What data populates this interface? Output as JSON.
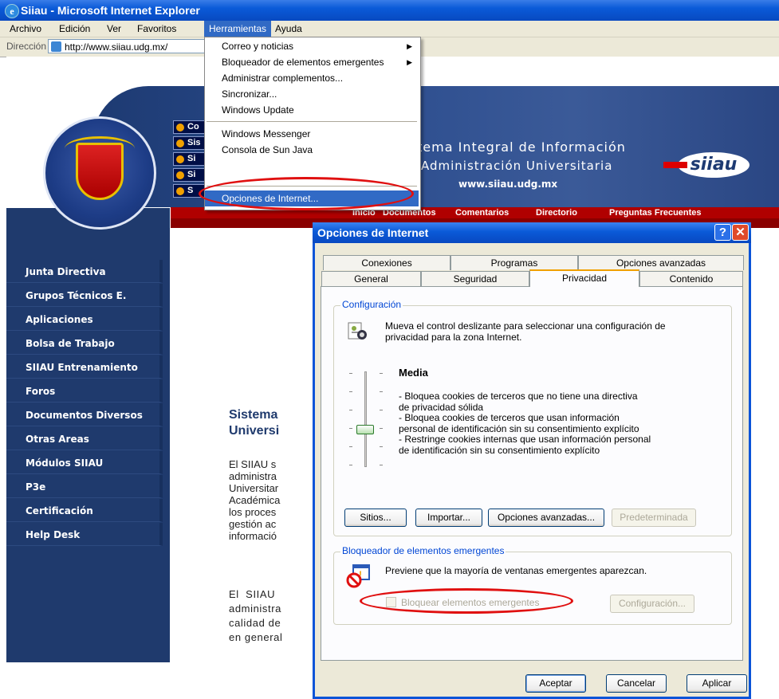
{
  "window": {
    "title": "Siiau - Microsoft Internet Explorer"
  },
  "menubar": {
    "items": [
      "Archivo",
      "Edición",
      "Ver",
      "Favoritos",
      "Herramientas",
      "Ayuda"
    ]
  },
  "addressbar": {
    "label": "Dirección",
    "value": "http://www.siiau.udg.mx/"
  },
  "tools_menu": {
    "items": [
      {
        "label": "Correo y noticias",
        "submenu": true
      },
      {
        "label": "Bloqueador de elementos emergentes",
        "submenu": true
      },
      {
        "label": "Administrar complementos..."
      },
      {
        "label": "Sincronizar..."
      },
      {
        "label": "Windows Update"
      },
      {
        "label": "Windows Messenger"
      },
      {
        "label": "Consola de Sun Java"
      },
      {
        "label": "Opciones de Internet..."
      }
    ]
  },
  "site": {
    "tabs": [
      "Co",
      "Sis",
      "Si",
      "Si",
      "S"
    ],
    "title_line1": "tema Integral de Información",
    "title_line2": "Administración Universitaria",
    "url": "www.siiau.udg.mx",
    "logo": "siiau",
    "nav_strip": [
      "Inicio",
      "Documentos",
      "Comentarios",
      "Directorio",
      "Preguntas Frecuentes"
    ],
    "left_nav": [
      "Junta Directiva",
      "Grupos Técnicos E.",
      "Aplicaciones",
      "Bolsa de Trabajo",
      "SIIAU Entrenamiento",
      "Foros",
      "Documentos Diversos",
      "Otras Areas",
      "Módulos SIIAU",
      "P3e",
      "Certificación",
      "Help Desk"
    ],
    "heading": "Sistema\nUniversi",
    "para1": "El SIIAU s\nadministra\nUniversitar\nAcadémica\nlos proces\ngestión ac\ninformació",
    "para2": "El  SIIAU\nadministra\ncalidad de\nen general"
  },
  "dialog": {
    "title": "Opciones de Internet",
    "help_glyph": "?",
    "close_glyph": "✕",
    "tabs_row1": [
      "Conexiones",
      "Programas",
      "Opciones avanzadas"
    ],
    "tabs_row2": [
      "General",
      "Seguridad",
      "Privacidad",
      "Contenido"
    ],
    "active_tab": "Privacidad",
    "config_group": "Configuración",
    "config_desc": "Mueva el control deslizante para seleccionar una configuración de\nprivacidad para la zona Internet.",
    "level_name": "Media",
    "level_desc": "- Bloquea cookies de terceros que no tiene una directiva\nde privacidad sólida\n- Bloquea cookies de terceros que usan información\npersonal de identificación sin su consentimiento explícito\n- Restringe cookies internas que usan información personal\nde identificación sin su consentimiento explícito",
    "buttons_config": [
      "Sitios...",
      "Importar...",
      "Opciones avanzadas...",
      "Predeterminada"
    ],
    "popup_group": "Bloqueador de elementos emergentes",
    "popup_desc": "Previene que la mayoría de ventanas emergentes aparezcan.",
    "popup_checkbox": "Bloquear elementos emergentes",
    "popup_checked": false,
    "popup_config_button": "Configuración...",
    "footer_buttons": [
      "Aceptar",
      "Cancelar",
      "Aplicar"
    ]
  },
  "colors": {
    "highlight": "#316ac5",
    "annotation_oval": "#e01010",
    "xp_title": "#0a5ad8",
    "site_navy": "#1f3a6d"
  }
}
